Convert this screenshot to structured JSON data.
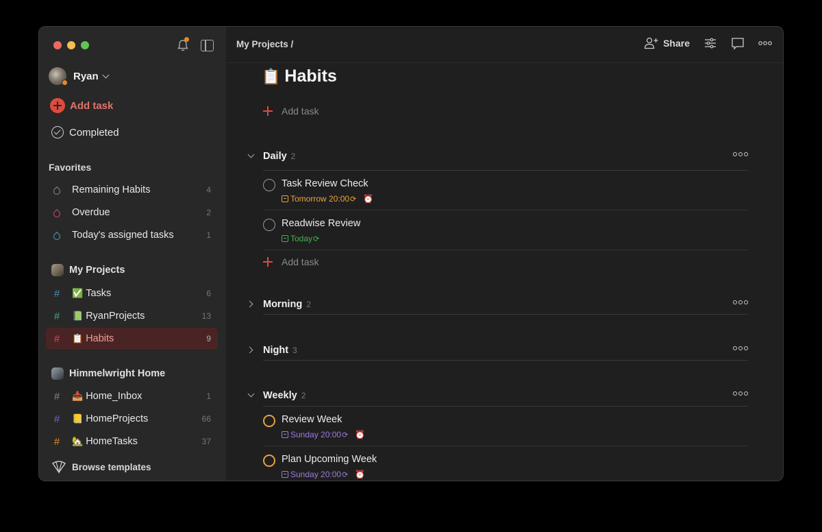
{
  "window": {
    "traffic_lights": [
      "close",
      "minimize",
      "maximize"
    ]
  },
  "sidebar": {
    "user": {
      "name": "Ryan"
    },
    "add_task_label": "Add task",
    "completed_label": "Completed",
    "favorites": {
      "title": "Favorites",
      "items": [
        {
          "label": "Remaining Habits",
          "count": "4",
          "icon": "filter-drop-icon",
          "color": "#8a8a8a"
        },
        {
          "label": "Overdue",
          "count": "2",
          "icon": "filter-drop-icon",
          "color": "#d9466b"
        },
        {
          "label": "Today's assigned tasks",
          "count": "1",
          "icon": "filter-drop-icon",
          "color": "#4aa3c2"
        }
      ]
    },
    "workspaces": [
      {
        "title": "My Projects",
        "projects": [
          {
            "emoji": "✅",
            "label": "Tasks",
            "count": "6",
            "hash_color": "#4a8ab5",
            "active": false
          },
          {
            "emoji": "📗",
            "label": "RyanProjects",
            "count": "13",
            "hash_color": "#47a58f",
            "active": false
          },
          {
            "emoji": "📋",
            "label": "Habits",
            "count": "9",
            "hash_color": "#d9466b",
            "active": true
          }
        ]
      },
      {
        "title": "Himmelwright Home",
        "projects": [
          {
            "emoji": "📥",
            "label": "Home_Inbox",
            "count": "1",
            "hash_color": "#888888",
            "active": false
          },
          {
            "emoji": "📒",
            "label": "HomeProjects",
            "count": "66",
            "hash_color": "#7b5cd6",
            "active": false
          },
          {
            "emoji": "🏡",
            "label": "HomeTasks",
            "count": "37",
            "hash_color": "#e8862d",
            "active": false
          }
        ]
      }
    ],
    "browse_templates_label": "Browse templates"
  },
  "topbar": {
    "breadcrumb": "My Projects /",
    "share_label": "Share"
  },
  "page": {
    "emoji": "📋",
    "title": "Habits",
    "add_task_label": "Add task"
  },
  "sections": [
    {
      "name": "Daily",
      "count": "2",
      "expanded": true,
      "tasks": [
        {
          "title": "Task Review Check",
          "due": "Tomorrow 20:00",
          "due_color": "#e8a33d",
          "recurring": true,
          "reminder": true,
          "priority_color": "#999999"
        },
        {
          "title": "Readwise Review",
          "due": "Today",
          "due_color": "#4caf50",
          "recurring": true,
          "reminder": false,
          "priority_color": "#999999"
        }
      ],
      "add_task_label": "Add task"
    },
    {
      "name": "Morning",
      "count": "2",
      "expanded": false,
      "tasks": []
    },
    {
      "name": "Night",
      "count": "3",
      "expanded": false,
      "tasks": []
    },
    {
      "name": "Weekly",
      "count": "2",
      "expanded": true,
      "tasks": [
        {
          "title": "Review Week",
          "due": "Sunday 20:00",
          "due_color": "#9b7be0",
          "recurring": true,
          "reminder": true,
          "priority_color": "#e8a33d"
        },
        {
          "title": "Plan Upcoming Week",
          "due": "Sunday 20:00",
          "due_color": "#9b7be0",
          "recurring": true,
          "reminder": true,
          "priority_color": "#e8a33d"
        }
      ]
    }
  ]
}
